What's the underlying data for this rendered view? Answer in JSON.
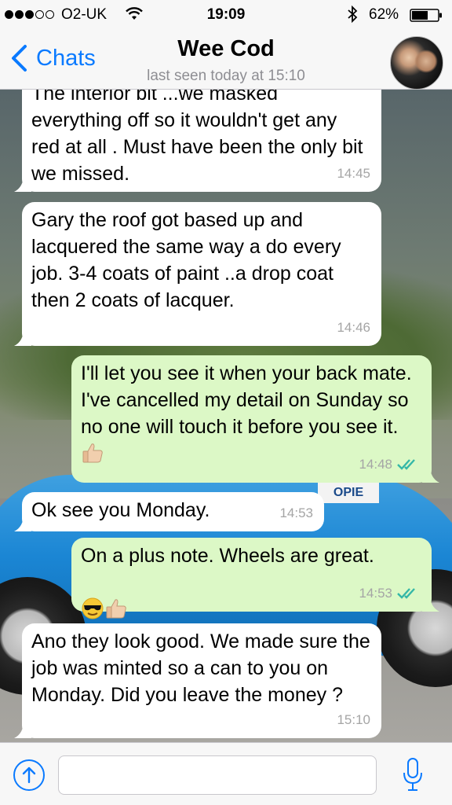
{
  "status_bar": {
    "carrier": "O2-UK",
    "time": "19:09",
    "battery": "62%",
    "signal_bars_filled": 3,
    "signal_bars_total": 5,
    "battery_level": 0.62
  },
  "header": {
    "back_label": "Chats",
    "contact_name": "Wee Cod",
    "last_seen": "last seen today at 15:10"
  },
  "messages": [
    {
      "direction": "in",
      "text": "The interior bit ...we masked everything off so it wouldn't get any red at all . Must have been the only bit we missed.",
      "time": "14:45"
    },
    {
      "direction": "in",
      "text": "Gary the roof got based up and lacquered the same way a do every job. 3-4 coats of paint ..a drop coat then 2 coats of lacquer.",
      "time": "14:46"
    },
    {
      "direction": "out",
      "text": "I'll let you see it when your back mate. I've cancelled my detail on Sunday so no one will touch it before you see it.",
      "emoji": [
        "thumbs-up"
      ],
      "time": "14:48",
      "status": "read"
    },
    {
      "direction": "in",
      "text": "Ok see you Monday.",
      "time": "14:53"
    },
    {
      "direction": "out",
      "text": "On a plus note. Wheels are great.",
      "emoji": [
        "sunglasses-face",
        "thumbs-up"
      ],
      "time": "14:53",
      "status": "read"
    },
    {
      "direction": "in",
      "text": "Ano they look good. We made sure the job was minted so a can to you on Monday. Did you leave the money ?",
      "time": "15:10"
    }
  ],
  "background_sticker": "OPIE",
  "input": {
    "placeholder": "",
    "value": ""
  },
  "colors": {
    "accent": "#0a7aff",
    "incoming_bubble": "#ffffff",
    "outgoing_bubble": "#dcf8c6",
    "read_ticks": "#34b7a7",
    "timestamp": "#a5a5a5"
  },
  "icons": [
    "back-chevron-icon",
    "wifi-icon",
    "bluetooth-icon",
    "battery-icon",
    "attach-icon",
    "microphone-icon",
    "double-check-icon",
    "thumbs-up-emoji",
    "sunglasses-emoji"
  ]
}
